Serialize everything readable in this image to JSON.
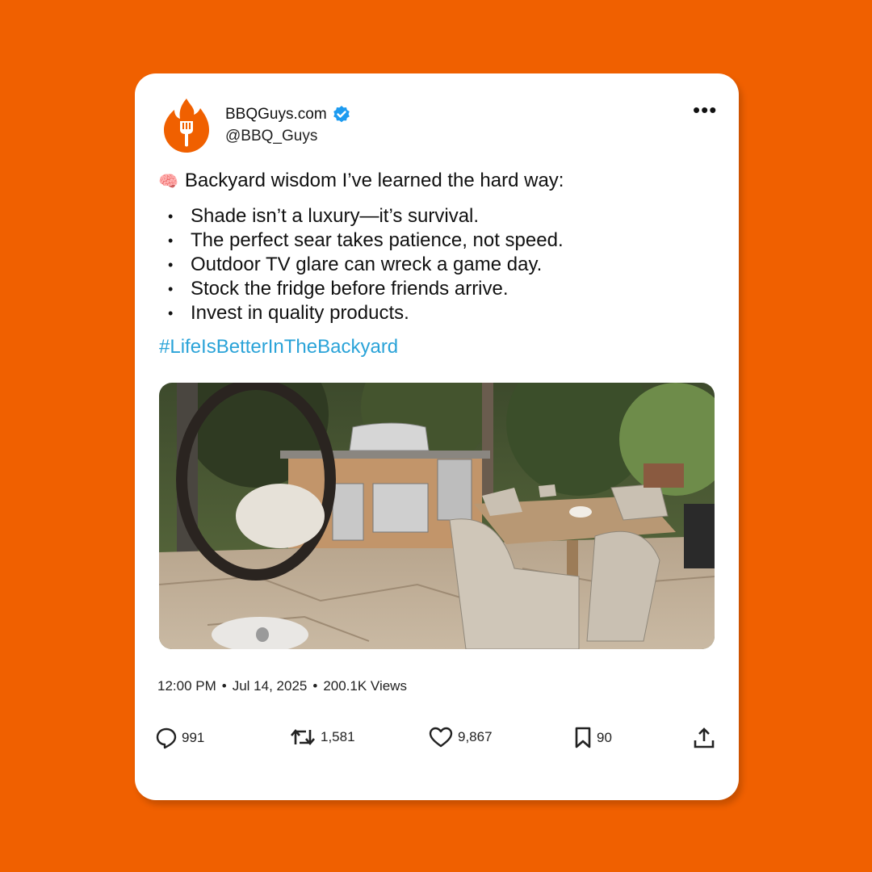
{
  "account": {
    "display_name": "BBQGuys.com",
    "handle": "@BBQ_Guys",
    "verified": true
  },
  "post": {
    "intro_emoji": "🧠",
    "intro": "Backyard wisdom I’ve learned the hard way:",
    "bullets": [
      "Shade isn’t a luxury—it’s survival.",
      "The perfect sear takes patience, not speed.",
      "Outdoor TV glare can wreck a game day.",
      "Stock the fridge before friends arrive.",
      "Invest in quality products."
    ],
    "hashtag": "#LifeIsBetterInTheBackyard",
    "image_icon": "backyard-patio-photo"
  },
  "meta": {
    "time": "12:00 PM",
    "date": "Jul 14, 2025",
    "views": "200.1K Views"
  },
  "actions": {
    "replies": "991",
    "reposts": "1,581",
    "likes": "9,867",
    "bookmarks": "90"
  },
  "colors": {
    "background": "#f06000",
    "brand": "#f06000",
    "hashtag": "#2aa3d8",
    "verified": "#1d9bf0"
  }
}
